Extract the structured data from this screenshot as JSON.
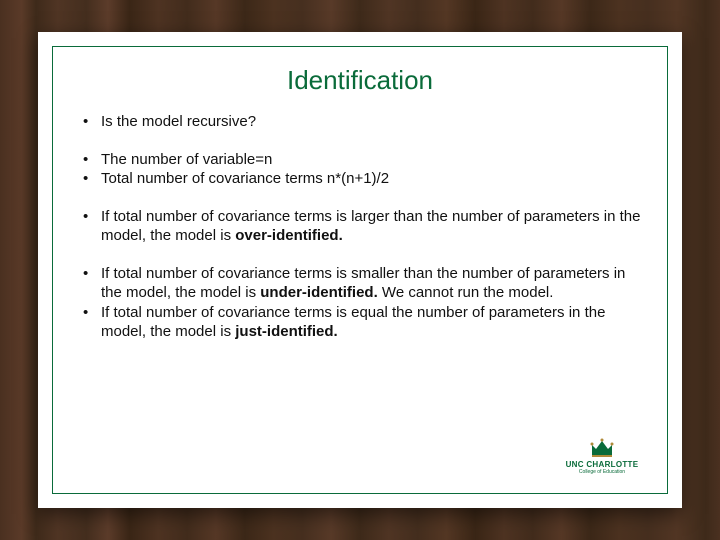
{
  "title": "Identification",
  "bullets": {
    "g1": {
      "b1": "Is the model recursive?"
    },
    "g2": {
      "b1": "The number of variable=n",
      "b2": "Total number of covariance terms n*(n+1)/2"
    },
    "g3": {
      "b1_pre": "If total number of covariance terms is larger than the number of parameters in the model, the model is ",
      "b1_bold": "over-identified."
    },
    "g4": {
      "b1_pre": "If total number of covariance terms is smaller than the number of parameters in the model, the model is ",
      "b1_bold": "under-identified.",
      "b1_post": " We cannot run the model.",
      "b2_pre": "If total number of covariance terms is equal the number of parameters in the model, the model is ",
      "b2_bold": "just-identified."
    }
  },
  "logo": {
    "name": "UNC CHARLOTTE",
    "sub": "College of Education"
  },
  "colors": {
    "accent": "#0a6b3a",
    "gold": "#b08a3a"
  }
}
